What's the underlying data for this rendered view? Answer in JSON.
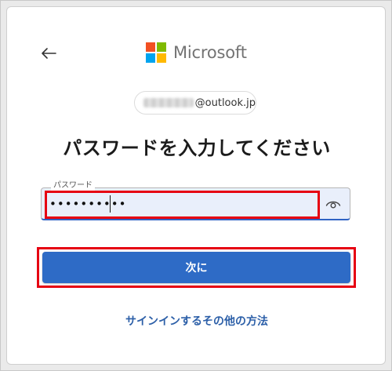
{
  "brand": {
    "name": "Microsoft",
    "logo_colors": [
      "#f25022",
      "#7fba00",
      "#00a4ef",
      "#ffb900"
    ]
  },
  "navigation": {
    "back_icon": "arrow-left-icon"
  },
  "account": {
    "masked_prefix": "",
    "domain": "@outlook.jp"
  },
  "heading": "パスワードを入力してください",
  "password": {
    "label": "パスワード",
    "value": "••••••••••",
    "reveal_icon": "eye-icon"
  },
  "actions": {
    "next_label": "次に",
    "other_signin_label": "サインインするその他の方法"
  },
  "colors": {
    "accent": "#2e6bc6",
    "highlight": "#e60012",
    "link": "#2c5fa8"
  }
}
